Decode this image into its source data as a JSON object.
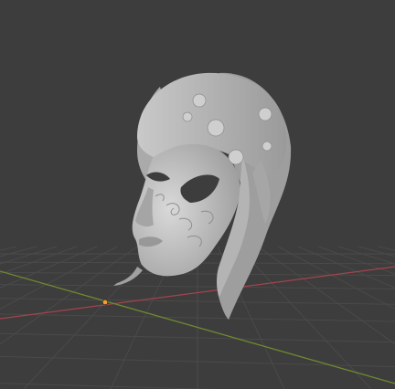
{
  "viewport": {
    "background": "#3d3d3d",
    "grid_color": "#4a4a4a",
    "x_axis_color": "#a4434d",
    "y_axis_color": "#6d8a2f",
    "origin_color": "#f0a030"
  },
  "object": {
    "name": "sculpted-venetian-mask",
    "material_color": "#b9b9b9",
    "shadow_color": "#8a8a8a",
    "highlight_color": "#d8d8d8"
  }
}
